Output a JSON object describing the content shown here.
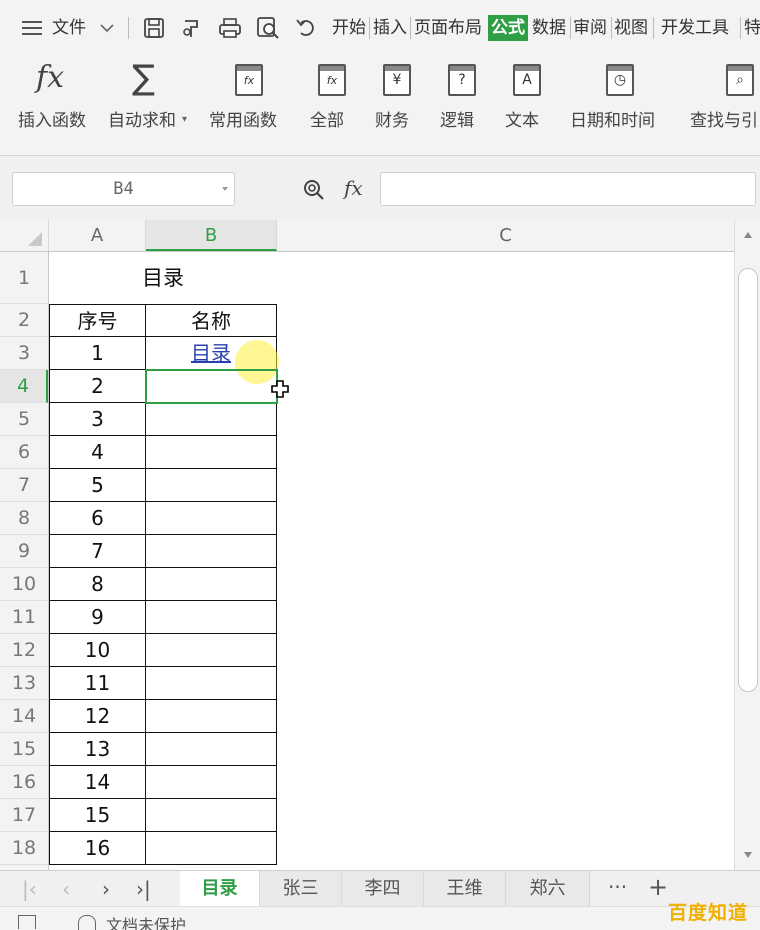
{
  "menubar": {
    "file_label": "文件",
    "tabs": [
      "开始",
      "插入",
      "页面布局",
      "公式",
      "数据",
      "审阅",
      "视图",
      "开发工具",
      "特"
    ],
    "active_tab": "公式"
  },
  "ribbon": {
    "items": [
      "插入函数",
      "自动求和",
      "常用函数",
      "全部",
      "财务",
      "逻辑",
      "文本",
      "日期和时间",
      "查找与引"
    ],
    "icons": [
      "fx-icon",
      "sigma-icon",
      "star-function-icon",
      "all-function-icon",
      "yen-icon",
      "question-icon",
      "text-icon",
      "clock-icon",
      "lookup-icon"
    ]
  },
  "formula_bar": {
    "name_box": "B4",
    "fx_label": "fx",
    "formula": ""
  },
  "columns": [
    "A",
    "B",
    "C"
  ],
  "selected_column": "B",
  "rows": [
    "1",
    "2",
    "3",
    "4",
    "5",
    "6",
    "7",
    "8",
    "9",
    "10",
    "11",
    "12",
    "13",
    "14",
    "15",
    "16",
    "17",
    "18"
  ],
  "selected_row": "4",
  "sheet": {
    "title": "目录",
    "header_index": "序号",
    "header_name": "名称",
    "link_text": "目录",
    "indices": [
      "1",
      "2",
      "3",
      "4",
      "5",
      "6",
      "7",
      "8",
      "9",
      "10",
      "11",
      "12",
      "13",
      "14",
      "15",
      "16"
    ]
  },
  "sheet_tabs": [
    "目录",
    "张三",
    "李四",
    "王维",
    "郑六"
  ],
  "active_sheet": "目录",
  "more_label": "···",
  "add_label": "+",
  "status": {
    "protect_label": "文档未保护"
  },
  "watermark": "百度知道",
  "colors": {
    "accent": "#2f9e45",
    "link": "#2a3fb0",
    "watermark": "#f0b000"
  }
}
